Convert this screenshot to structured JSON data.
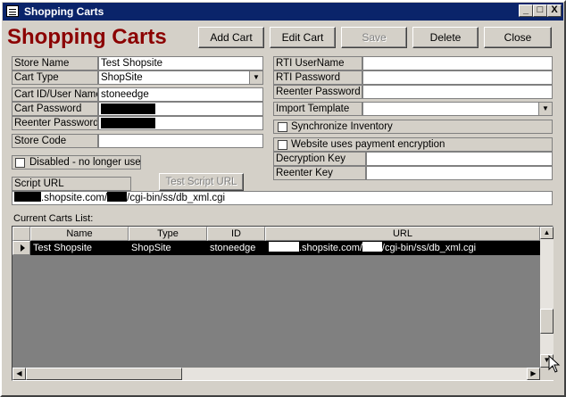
{
  "window": {
    "title": "Shopping Carts",
    "controls": {
      "minimize": "_",
      "maximize": "□",
      "close": "X"
    }
  },
  "form": {
    "heading": "Shopping Carts",
    "buttons": {
      "add_cart": "Add Cart",
      "edit_cart": "Edit Cart",
      "save": "Save",
      "delete": "Delete",
      "close": "Close"
    },
    "fields": {
      "store_name_label": "Store Name",
      "store_name_value": "Test Shopsite",
      "cart_type_label": "Cart Type",
      "cart_type_value": "ShopSite",
      "cart_id_label": "Cart ID/User Name",
      "cart_id_value": "stoneedge",
      "cart_password_label": "Cart Password",
      "reenter_password_label": "Reenter Password",
      "store_code_label": "Store Code",
      "store_code_value": "",
      "disabled_label": "Disabled - no longer used",
      "disabled_checked": false,
      "script_url_label": "Script URL",
      "test_script_url": "Test Script URL",
      "script_url_part1": ".shopsite.com/",
      "script_url_part2": "/cgi-bin/ss/db_xml.cgi",
      "rti_username_label": "RTI UserName",
      "rti_username_value": "",
      "rti_password_label": "RTI Password",
      "rti_password_value": "",
      "rti_reenter_label": "Reenter Password",
      "rti_reenter_value": "",
      "import_template_label": "Import Template",
      "import_template_value": "",
      "sync_inventory_label": "Synchronize Inventory",
      "sync_inventory_checked": false,
      "payment_encryption_label": "Website uses payment encryption",
      "payment_encryption_checked": false,
      "decryption_key_label": "Decryption Key",
      "decryption_key_value": "",
      "reenter_key_label": "Reenter Key",
      "reenter_key_value": ""
    },
    "carts_list": {
      "label": "Current Carts List:",
      "columns": [
        "Name",
        "Type",
        "ID",
        "URL"
      ],
      "rows": [
        {
          "name": "Test Shopsite",
          "type": "ShopSite",
          "id": "stoneedge",
          "url_part1": ".shopsite.com/",
          "url_part2": "/cgi-bin/ss/db_xml.cgi"
        }
      ]
    }
  },
  "colors": {
    "title_bar": "#0a246a",
    "heading": "#8b0000",
    "grid_background": "#808080",
    "selected_row": "#000000",
    "face": "#d4d0c8"
  }
}
